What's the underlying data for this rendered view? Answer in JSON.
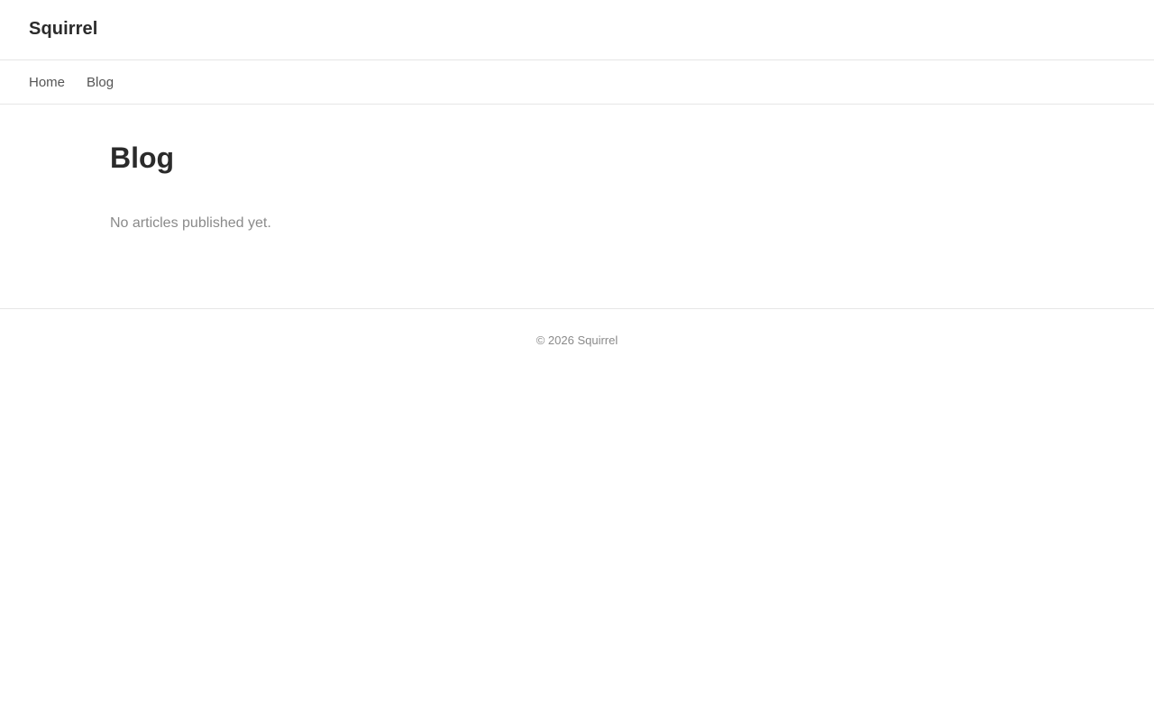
{
  "header": {
    "brand": "Squirrel"
  },
  "nav": {
    "items": [
      {
        "label": "Home"
      },
      {
        "label": "Blog"
      }
    ]
  },
  "main": {
    "title": "Blog",
    "empty_message": "No articles published yet."
  },
  "footer": {
    "text": "© 2026 Squirrel"
  },
  "colors": {
    "text": "#2b2b2b",
    "muted": "#8a8a8a",
    "nav_text": "#555555",
    "border": "#e6e6e6",
    "background": "#ffffff"
  }
}
